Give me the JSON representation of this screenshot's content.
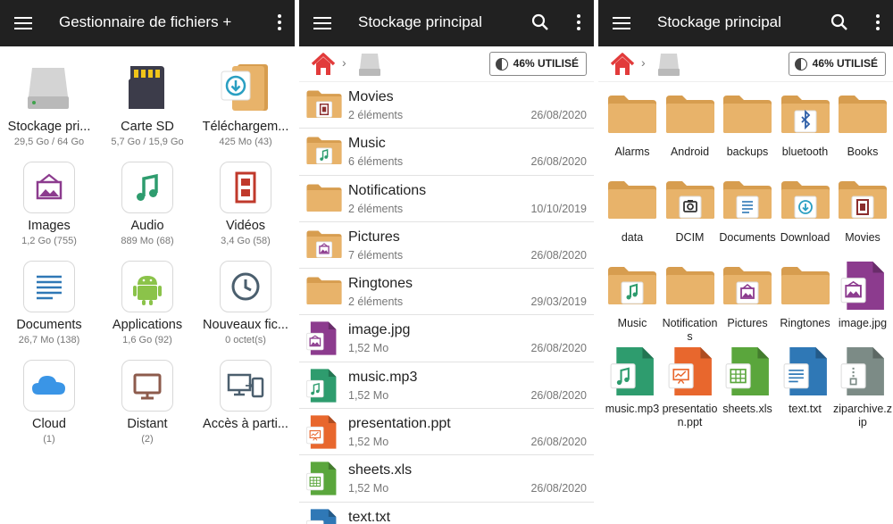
{
  "colors": {
    "appbar": "#212121",
    "folder": "#e8b36a",
    "folder_dark": "#d79d4f",
    "image_purple": "#8c3b8e",
    "audio_green": "#2e9c6e",
    "ppt_orange": "#e8672d",
    "xls_green": "#5aa63c",
    "txt_blue": "#2f78b6",
    "zip_gray": "#7c8b86"
  },
  "panel1": {
    "title": "Gestionnaire de fichiers +",
    "tiles": [
      {
        "label": "Stockage pri...",
        "sub": "29,5 Go / 64 Go",
        "icon": "hard-drive-icon"
      },
      {
        "label": "Carte SD",
        "sub": "5,7 Go / 15,9 Go",
        "icon": "sd-card-icon"
      },
      {
        "label": "Téléchargem...",
        "sub": "425 Mo (43)",
        "icon": "download-folder-icon"
      },
      {
        "label": "Images",
        "sub": "1,2 Go (755)",
        "icon": "image-icon"
      },
      {
        "label": "Audio",
        "sub": "889 Mo (68)",
        "icon": "music-note-icon"
      },
      {
        "label": "Vidéos",
        "sub": "3,4 Go (58)",
        "icon": "film-icon"
      },
      {
        "label": "Documents",
        "sub": "26,7 Mo (138)",
        "icon": "document-icon"
      },
      {
        "label": "Applications",
        "sub": "1,6 Go (92)",
        "icon": "android-icon"
      },
      {
        "label": "Nouveaux fic...",
        "sub": "0 octet(s)",
        "icon": "clock-icon"
      },
      {
        "label": "Cloud",
        "sub": "(1)",
        "icon": "cloud-icon"
      },
      {
        "label": "Distant",
        "sub": "(2)",
        "icon": "monitor-icon"
      },
      {
        "label": "Accès à parti...",
        "sub": "",
        "icon": "devices-icon"
      }
    ]
  },
  "panel2": {
    "title": "Stockage principal",
    "usage": "46% UTILISÉ",
    "rows": [
      {
        "name": "Movies",
        "meta": "2 éléments",
        "date": "26/08/2020",
        "icon": "film-folder-icon"
      },
      {
        "name": "Music",
        "meta": "6 éléments",
        "date": "26/08/2020",
        "icon": "music-folder-icon"
      },
      {
        "name": "Notifications",
        "meta": "2 éléments",
        "date": "10/10/2019",
        "icon": "folder-icon"
      },
      {
        "name": "Pictures",
        "meta": "7 éléments",
        "date": "26/08/2020",
        "icon": "image-folder-icon"
      },
      {
        "name": "Ringtones",
        "meta": "2 éléments",
        "date": "29/03/2019",
        "icon": "folder-icon"
      },
      {
        "name": "image.jpg",
        "meta": "1,52 Mo",
        "date": "26/08/2020",
        "icon": "image-file-icon"
      },
      {
        "name": "music.mp3",
        "meta": "1,52 Mo",
        "date": "26/08/2020",
        "icon": "audio-file-icon"
      },
      {
        "name": "presentation.ppt",
        "meta": "1,52 Mo",
        "date": "26/08/2020",
        "icon": "presentation-file-icon"
      },
      {
        "name": "sheets.xls",
        "meta": "1,52 Mo",
        "date": "26/08/2020",
        "icon": "spreadsheet-file-icon"
      },
      {
        "name": "text.txt",
        "meta": "",
        "date": "",
        "icon": "text-file-icon"
      }
    ]
  },
  "panel3": {
    "title": "Stockage principal",
    "usage": "46% UTILISÉ",
    "items": [
      {
        "label": "Alarms",
        "icon": "folder-icon"
      },
      {
        "label": "Android",
        "icon": "folder-icon"
      },
      {
        "label": "backups",
        "icon": "folder-icon"
      },
      {
        "label": "bluetooth",
        "icon": "bluetooth-folder-icon"
      },
      {
        "label": "Books",
        "icon": "folder-icon"
      },
      {
        "label": "data",
        "icon": "folder-icon"
      },
      {
        "label": "DCIM",
        "icon": "camera-folder-icon"
      },
      {
        "label": "Documents",
        "icon": "document-folder-icon"
      },
      {
        "label": "Download",
        "icon": "download-folder-icon"
      },
      {
        "label": "Movies",
        "icon": "film-folder-icon"
      },
      {
        "label": "Music",
        "icon": "music-folder-icon"
      },
      {
        "label": "Notifications",
        "icon": "folder-icon"
      },
      {
        "label": "Pictures",
        "icon": "image-folder-icon"
      },
      {
        "label": "Ringtones",
        "icon": "folder-icon"
      },
      {
        "label": "image.jpg",
        "icon": "image-file-icon"
      },
      {
        "label": "music.mp3",
        "icon": "audio-file-icon"
      },
      {
        "label": "presentation.ppt",
        "icon": "presentation-file-icon"
      },
      {
        "label": "sheets.xls",
        "icon": "spreadsheet-file-icon"
      },
      {
        "label": "text.txt",
        "icon": "text-file-icon"
      },
      {
        "label": "ziparchive.zip",
        "icon": "zip-file-icon"
      }
    ]
  }
}
